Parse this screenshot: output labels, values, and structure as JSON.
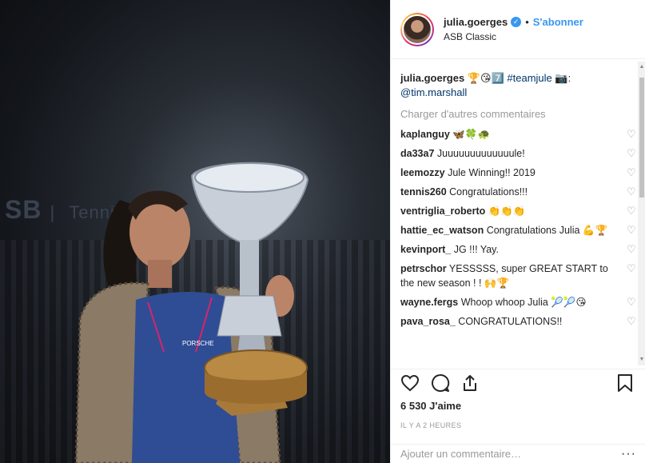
{
  "photo": {
    "banner_left": "SB",
    "banner_right": "Tennis",
    "shirt_text": "PORSCHE"
  },
  "header": {
    "username": "julia.goerges",
    "verified_icon": "verified-badge-icon",
    "dot": "•",
    "follow_label": "S'abonner",
    "location": "ASB Classic"
  },
  "caption": {
    "username": "julia.goerges",
    "emojis": "🏆😘7️⃣",
    "hashtag": "#teamjule",
    "camera": "📷:",
    "mention": "@tim.marshall"
  },
  "load_more": "Charger d'autres commentaires",
  "comments": [
    {
      "user": "kaplanguy",
      "text": "🦋🍀🐢"
    },
    {
      "user": "da33a7",
      "text": "Juuuuuuuuuuuuule!"
    },
    {
      "user": "leemozzy",
      "text": "Jule Winning!! 2019"
    },
    {
      "user": "tennis260",
      "text": "Congratulations!!!"
    },
    {
      "user": "ventriglia_roberto",
      "text": "👏👏👏"
    },
    {
      "user": "hattie_ec_watson",
      "text": "Congratulations Julia 💪🏆"
    },
    {
      "user": "kevinport_",
      "text": "JG !!! Yay."
    },
    {
      "user": "petrschor",
      "text": "YESSSSS, super GREAT START to the new season ! ! 🙌🏆"
    },
    {
      "user": "wayne.fergs",
      "text": "Whoop whoop Julia 🎾🎾😘"
    },
    {
      "user": "pava_rosa_",
      "text": "CONGRATULATIONS!!"
    }
  ],
  "likes": "6 530 J'aime",
  "timestamp": "IL Y A 2 HEURES",
  "add_comment": {
    "placeholder": "Ajouter un commentaire…",
    "more": "···"
  },
  "icons": [
    "heart-icon",
    "comment-icon",
    "share-icon",
    "bookmark-icon"
  ]
}
